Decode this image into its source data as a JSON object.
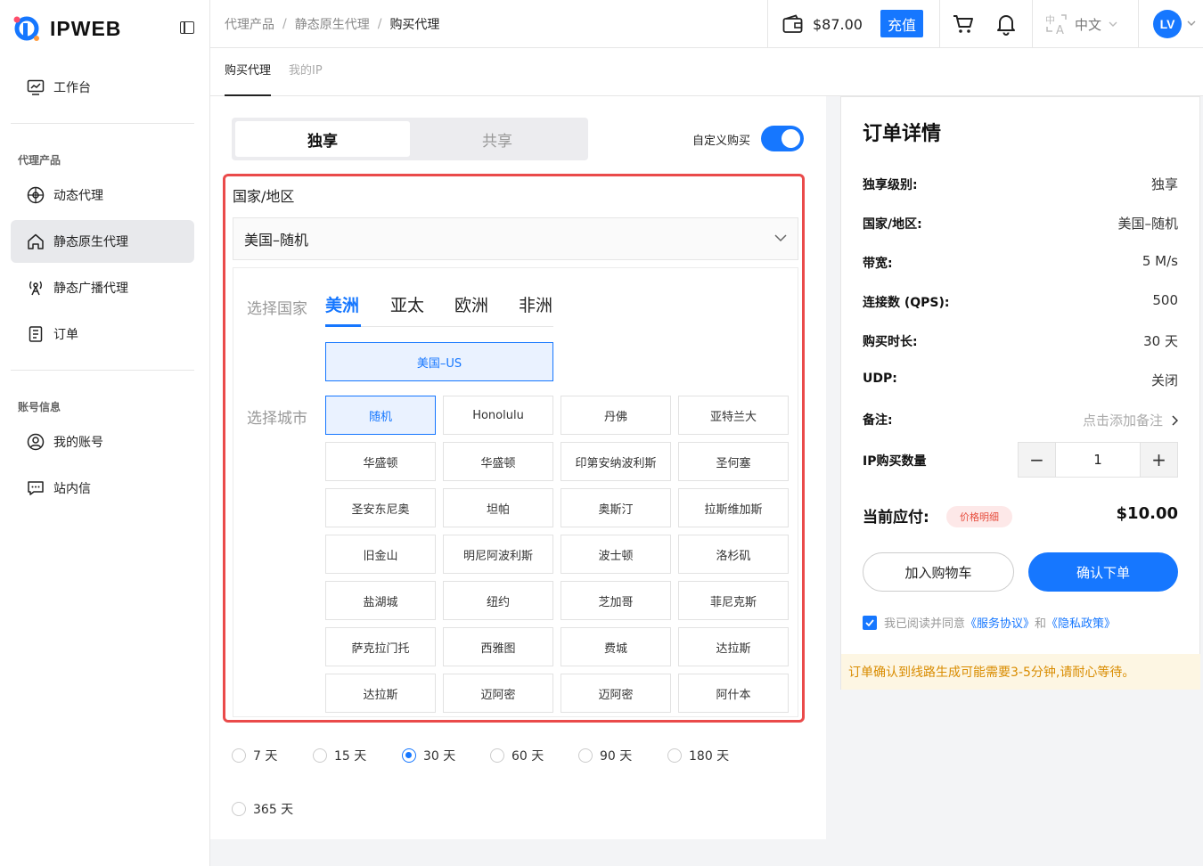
{
  "brand": {
    "name": "IPWEB"
  },
  "sidebar": {
    "workbench": "工作台",
    "section_proxy": "代理产品",
    "proxy_items": [
      "动态代理",
      "静态原生代理",
      "静态广播代理",
      "订单"
    ],
    "section_account": "账号信息",
    "account_items": [
      "我的账号",
      "站内信"
    ]
  },
  "header": {
    "breadcrumb": [
      "代理产品",
      "静态原生代理",
      "购买代理"
    ],
    "balance": "$87.00",
    "recharge": "充值",
    "language": "中文",
    "avatar": "LV"
  },
  "subtabs": [
    "购买代理",
    "我的IP"
  ],
  "purchase": {
    "type_tabs": [
      "独享",
      "共享"
    ],
    "custom_buy": "自定义购买",
    "custom_buy_on": true,
    "region_label": "国家/地区",
    "selected_region": "美国–随机",
    "select_country_label": "选择国家",
    "continents": [
      "美洲",
      "亚太",
      "欧洲",
      "非洲"
    ],
    "country": "美国–US",
    "select_city_label": "选择城市",
    "cities": [
      "随机",
      "Honolulu",
      "丹佛",
      "亚特兰大",
      "华盛顿",
      "华盛顿",
      "印第安纳波利斯",
      "圣何塞",
      "圣安东尼奥",
      "坦帕",
      "奥斯汀",
      "拉斯维加斯",
      "旧金山",
      "明尼阿波利斯",
      "波士顿",
      "洛杉矶",
      "盐湖城",
      "纽约",
      "芝加哥",
      "菲尼克斯",
      "萨克拉门托",
      "西雅图",
      "费城",
      "达拉斯",
      "达拉斯",
      "迈阿密",
      "迈阿密",
      "阿什本"
    ],
    "selected_city": "随机",
    "durations": [
      "7 天",
      "15 天",
      "30 天",
      "60 天",
      "90 天",
      "180 天",
      "365 天"
    ],
    "selected_duration": "30 天"
  },
  "order": {
    "title": "订单详情",
    "rows": [
      {
        "label": "独享级别:",
        "value": "独享"
      },
      {
        "label": "国家/地区:",
        "value": "美国–随机"
      },
      {
        "label": "带宽:",
        "value": "5 M/s"
      },
      {
        "label": "连接数 (QPS):",
        "value": "500"
      },
      {
        "label": "购买时长:",
        "value": "30 天"
      },
      {
        "label": "UDP:",
        "value": "关闭"
      }
    ],
    "note_label": "备注:",
    "note_placeholder": "点击添加备注",
    "qty_label": "IP购买数量",
    "qty": "1",
    "total_label": "当前应付:",
    "price_detail": "价格明细",
    "total": "$10.00",
    "add_cart": "加入购物车",
    "confirm": "确认下单",
    "agree_prefix": "我已阅读并同意",
    "service_link": "《服务协议》",
    "and": "和",
    "privacy_link": "《隐私政策》",
    "notice": "订单确认到线路生成可能需要3-5分钟,请耐心等待。"
  },
  "colors": {
    "accent": "#1677ff",
    "highlight_border": "#ea4a4a",
    "notice_text": "#d98c00"
  }
}
